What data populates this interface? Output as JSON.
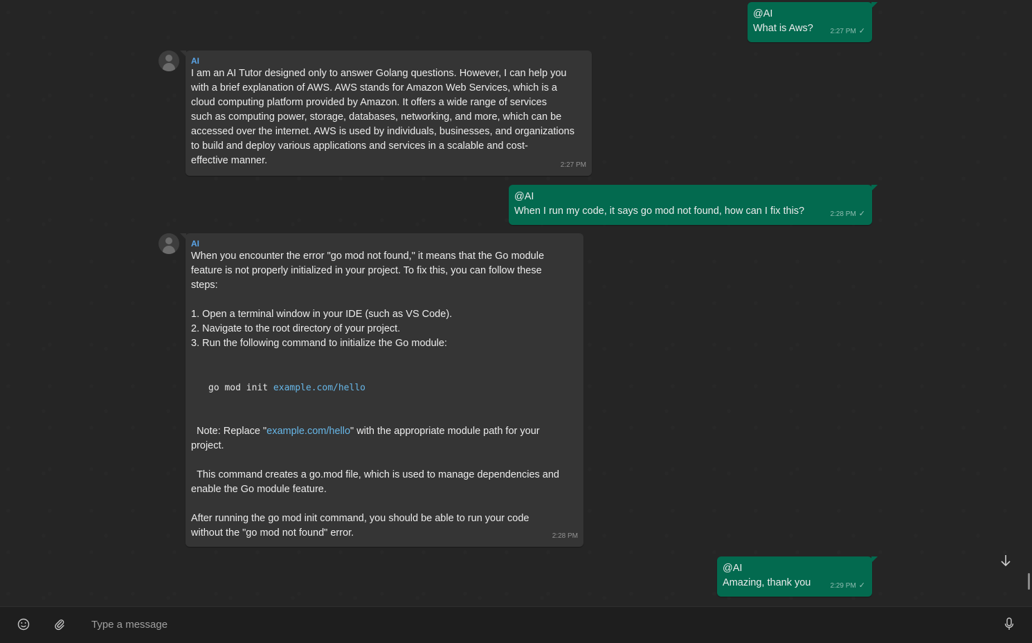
{
  "messages": [
    {
      "sender": "",
      "mention": "@AI",
      "text": "What is Aws?",
      "time": "2:27 PM",
      "status": "✓"
    },
    {
      "sender": "AI",
      "text": "I am an AI Tutor designed only to answer Golang questions. However, I can help you\nwith a brief explanation of AWS. AWS stands for Amazon Web Services, which is a\ncloud computing platform provided by Amazon. It offers a wide range of services\nsuch as computing power, storage, databases, networking, and more, which can be\naccessed over the internet. AWS is used by individuals, businesses, and organizations\nto build and deploy various applications and services in a scalable and cost-\neffective manner.",
      "time": "2:27 PM"
    },
    {
      "sender": "",
      "mention": "@AI",
      "text": "When I run my code, it says go mod not found, how can I fix this?",
      "time": "2:28 PM",
      "status": "✓"
    },
    {
      "sender": "AI",
      "intro": "When you encounter the error \"go mod not found,\" it means that the Go module\nfeature is not properly initialized in your project. To fix this, you can follow these\nsteps:\n\n1. Open a terminal window in your IDE (such as VS Code).\n2. Navigate to the root directory of your project.\n3. Run the following command to initialize the Go module:",
      "code_cmd": "go mod init ",
      "code_arg": "example.com/hello",
      "note_prefix": "  Note: Replace \"",
      "note_link": "example.com/hello",
      "note_suffix": "\" with the appropriate module path for your\nproject.\n\n  This command creates a go.mod file, which is used to manage dependencies and\nenable the Go module feature.\n\nAfter running the go mod init command, you should be able to run your code\nwithout the \"go mod not found\" error.",
      "time": "2:28 PM"
    },
    {
      "sender": "",
      "mention": "@AI",
      "text": "Amazing, thank you",
      "time": "2:29 PM",
      "status": "✓"
    }
  ],
  "composer": {
    "placeholder": "Type a message",
    "emoji_icon": "emoji-icon",
    "attach_icon": "paperclip-icon",
    "mic_icon": "microphone-icon"
  },
  "colors": {
    "outgoing_bubble": "#036a4f",
    "incoming_bubble": "#353535",
    "sender_name": "#5aa5e8",
    "link": "#67b7e8"
  }
}
